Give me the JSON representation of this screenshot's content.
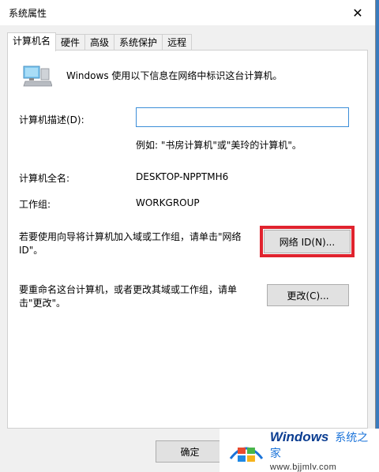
{
  "window": {
    "title": "系统属性",
    "close_glyph": "✕"
  },
  "tabs": [
    {
      "label": "计算机名",
      "active": true
    },
    {
      "label": "硬件",
      "active": false
    },
    {
      "label": "高级",
      "active": false
    },
    {
      "label": "系统保护",
      "active": false
    },
    {
      "label": "远程",
      "active": false
    }
  ],
  "panel": {
    "intro": "Windows 使用以下信息在网络中标识这台计算机。",
    "description_label": "计算机描述(D):",
    "description_value": "",
    "description_example": "例如: \"书房计算机\"或\"美玲的计算机\"。",
    "full_name_label": "计算机全名:",
    "full_name_value": "DESKTOP-NPPTMH6",
    "workgroup_label": "工作组:",
    "workgroup_value": "WORKGROUP",
    "network_text": "若要使用向导将计算机加入域或工作组，请单击\"网络 ID\"。",
    "network_button": "网络 ID(N)...",
    "rename_text": "要重命名这台计算机，或者更改其域或工作组，请单击\"更改\"。",
    "change_button": "更改(C)..."
  },
  "footer": {
    "ok_button": "确定"
  },
  "watermark": {
    "brand": "Windows",
    "brand_cn": "系统之家",
    "url": "www.bjjmlv.com"
  },
  "colors": {
    "highlight": "#e0232e",
    "input_border": "#3c8ed8",
    "background": "#f0f0f0"
  }
}
